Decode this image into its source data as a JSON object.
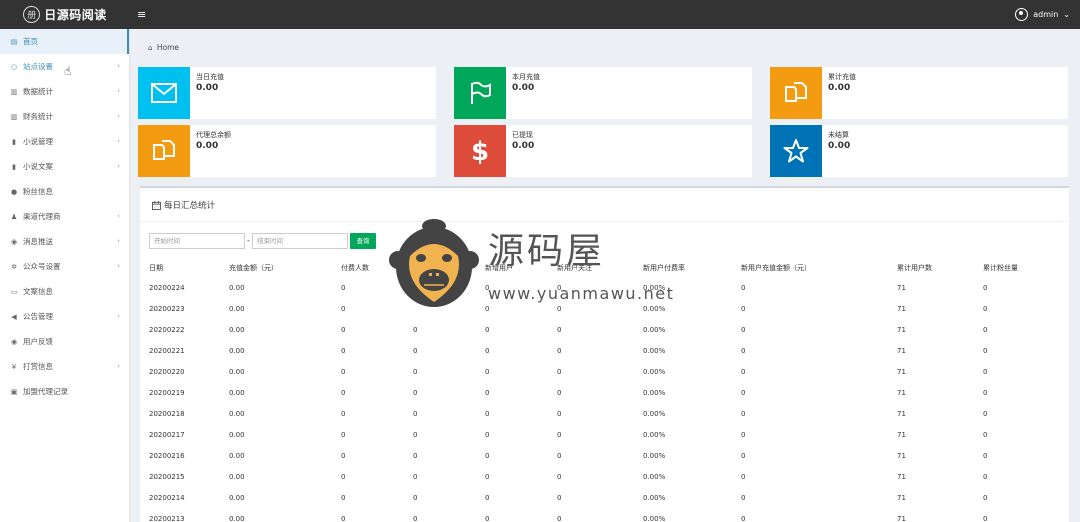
{
  "app": {
    "title": "日源码阅读",
    "logo_glyph": "册"
  },
  "header": {
    "toggle_glyph": "≡",
    "user": "admin",
    "caret": "⌄"
  },
  "sidebar": {
    "items": [
      {
        "label": "首页",
        "icon": "dashboard-icon",
        "glyph": "▤",
        "arrow": ""
      },
      {
        "label": "站点设置",
        "icon": "settings-icon",
        "glyph": "○",
        "arrow": "‹"
      },
      {
        "label": "数据统计",
        "icon": "bar-chart-icon",
        "glyph": "▥",
        "arrow": "‹"
      },
      {
        "label": "财务统计",
        "icon": "bar-chart-icon",
        "glyph": "▥",
        "arrow": "‹"
      },
      {
        "label": "小说管理",
        "icon": "book-icon",
        "glyph": "▮",
        "arrow": "‹"
      },
      {
        "label": "小说文案",
        "icon": "book-icon",
        "glyph": "▮",
        "arrow": "‹"
      },
      {
        "label": "粉丝信息",
        "icon": "users-icon",
        "glyph": "●",
        "arrow": ""
      },
      {
        "label": "渠道代理商",
        "icon": "user-plus-icon",
        "glyph": "♟",
        "arrow": "‹"
      },
      {
        "label": "消息推送",
        "icon": "comment-icon",
        "glyph": "◉",
        "arrow": "‹"
      },
      {
        "label": "公众号设置",
        "icon": "cogs-icon",
        "glyph": "✲",
        "arrow": "‹"
      },
      {
        "label": "文案信息",
        "icon": "document-icon",
        "glyph": "▭",
        "arrow": ""
      },
      {
        "label": "公告管理",
        "icon": "bullhorn-icon",
        "glyph": "◀",
        "arrow": "‹"
      },
      {
        "label": "用户反馈",
        "icon": "comments-icon",
        "glyph": "◉",
        "arrow": ""
      },
      {
        "label": "打赏信息",
        "icon": "yen-icon",
        "glyph": "¥",
        "arrow": "‹"
      },
      {
        "label": "加盟代理记录",
        "icon": "id-card-icon",
        "glyph": "▣",
        "arrow": ""
      }
    ]
  },
  "breadcrumb": {
    "home": "Home"
  },
  "stats": [
    {
      "label": "当日充值",
      "value": "0.00",
      "color": "#00c0ef",
      "icon": "envelope-icon"
    },
    {
      "label": "本月充值",
      "value": "0.00",
      "color": "#00a65a",
      "icon": "flag-icon"
    },
    {
      "label": "累计充值",
      "value": "0.00",
      "color": "#f39c12",
      "icon": "copy-icon"
    },
    {
      "label": "代理总余额",
      "value": "0.00",
      "color": "#f39c12",
      "icon": "copy-icon"
    },
    {
      "label": "已提现",
      "value": "0.00",
      "color": "#dd4b39",
      "icon": "dollar-icon"
    },
    {
      "label": "未结算",
      "value": "0.00",
      "color": "#0073b7",
      "icon": "star-icon"
    }
  ],
  "panel": {
    "title": "每日汇总统计",
    "start_placeholder": "开始时间",
    "end_placeholder": "结束时间",
    "dash": "-",
    "query_label": "查询"
  },
  "table": {
    "headers": [
      "日期",
      "充值金额（元）",
      "付费人数",
      "",
      "新增用户",
      "新用户关注",
      "新用户付费率",
      "新用户充值金额（元）",
      "累计用户数",
      "累计粉丝量"
    ],
    "rows": [
      [
        "20200224",
        "0.00",
        "0",
        "",
        "0",
        "0",
        "0.00%",
        "0",
        "71",
        "0"
      ],
      [
        "20200223",
        "0.00",
        "0",
        "",
        "0",
        "0",
        "0.00%",
        "0",
        "71",
        "0"
      ],
      [
        "20200222",
        "0.00",
        "0",
        "0",
        "0",
        "0",
        "0.00%",
        "0",
        "71",
        "0"
      ],
      [
        "20200221",
        "0.00",
        "0",
        "0",
        "0",
        "0",
        "0.00%",
        "0",
        "71",
        "0"
      ],
      [
        "20200220",
        "0.00",
        "0",
        "0",
        "0",
        "0",
        "0.00%",
        "0",
        "71",
        "0"
      ],
      [
        "20200219",
        "0.00",
        "0",
        "0",
        "0",
        "0",
        "0.00%",
        "0",
        "71",
        "0"
      ],
      [
        "20200218",
        "0.00",
        "0",
        "0",
        "0",
        "0",
        "0.00%",
        "0",
        "71",
        "0"
      ],
      [
        "20200217",
        "0.00",
        "0",
        "0",
        "0",
        "0",
        "0.00%",
        "0",
        "71",
        "0"
      ],
      [
        "20200216",
        "0.00",
        "0",
        "0",
        "0",
        "0",
        "0.00%",
        "0",
        "71",
        "0"
      ],
      [
        "20200215",
        "0.00",
        "0",
        "0",
        "0",
        "0",
        "0.00%",
        "0",
        "71",
        "0"
      ],
      [
        "20200214",
        "0.00",
        "0",
        "0",
        "0",
        "0",
        "0.00%",
        "0",
        "71",
        "0"
      ],
      [
        "20200213",
        "0.00",
        "0",
        "0",
        "0",
        "0",
        "0.00%",
        "0",
        "71",
        "0"
      ]
    ]
  },
  "watermark": {
    "title": "源码屋",
    "url": "www.yuanmawu.net"
  }
}
